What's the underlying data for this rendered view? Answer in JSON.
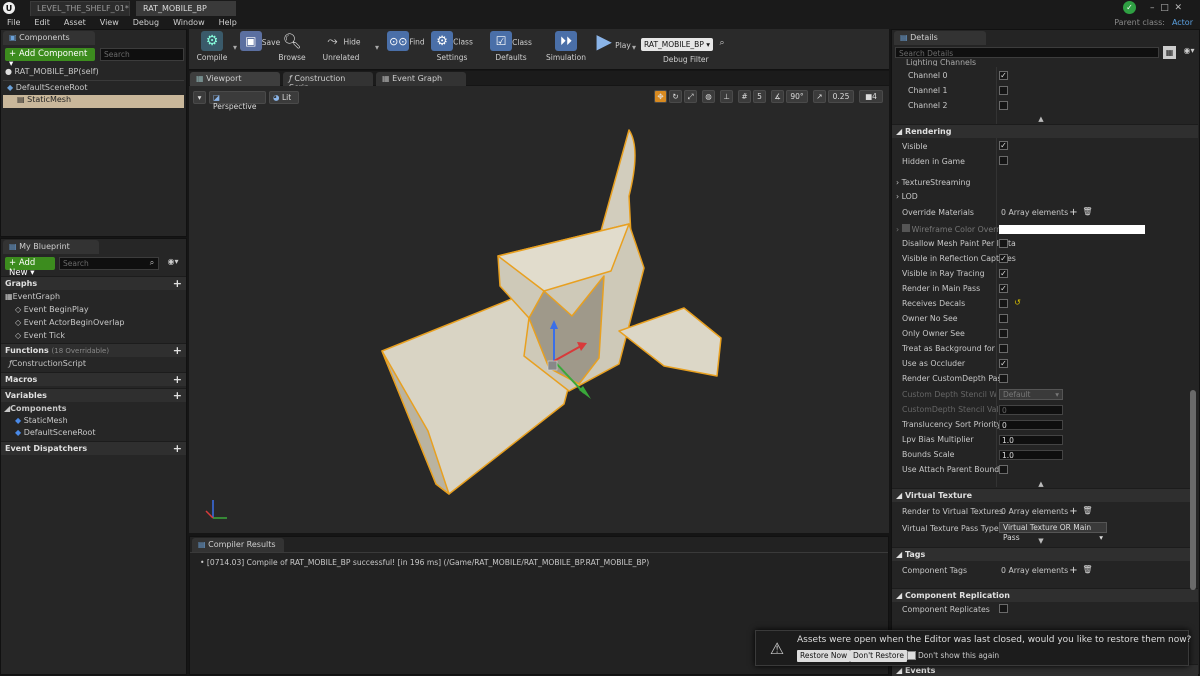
{
  "titlebar": {
    "tabs": [
      "LEVEL_THE_SHELF_01*",
      "RAT_MOBILE_BP"
    ],
    "parent_class_label": "Parent class:",
    "parent_class_value": "Actor"
  },
  "menu": [
    "File",
    "Edit",
    "Asset",
    "View",
    "Debug",
    "Window",
    "Help"
  ],
  "components": {
    "tab": "Components",
    "add_label": "+ Add Component",
    "search_placeholder": "Search",
    "self_label": "RAT_MOBILE_BP(self)",
    "items": [
      "DefaultSceneRoot",
      "StaticMesh"
    ]
  },
  "toolbar": {
    "buttons": [
      "Compile",
      "Save",
      "Browse",
      "Hide Unrelated",
      "Find",
      "Class Settings",
      "Class Defaults",
      "Simulation",
      "Play"
    ],
    "debug_select": "RAT_MOBILE_BP",
    "debug_label": "Debug Filter"
  },
  "editor_tabs": [
    "Viewport",
    "Construction Scrip",
    "Event Graph"
  ],
  "viewport": {
    "perspective": "Perspective",
    "lit": "Lit",
    "snap_angle": "90°",
    "snap_scale": "0.25",
    "snap_grid": "5",
    "camera_speed": "4"
  },
  "my_blueprint": {
    "tab": "My Blueprint",
    "add_label": "+ Add New",
    "search_placeholder": "Search",
    "graphs_header": "Graphs",
    "graph_items": [
      "EventGraph",
      "Event BeginPlay",
      "Event ActorBeginOverlap",
      "Event Tick"
    ],
    "functions_header": "Functions",
    "functions_note": "(18 Overridable)",
    "function_items": [
      "ConstructionScript"
    ],
    "macros_header": "Macros",
    "variables_header": "Variables",
    "components_sub": "Components",
    "variable_items": [
      "StaticMesh",
      "DefaultSceneRoot"
    ],
    "dispatchers_header": "Event Dispatchers"
  },
  "compiler": {
    "tab": "Compiler Results",
    "message": "[0714.03] Compile of RAT_MOBILE_BP successful! [in 196 ms] (/Game/RAT_MOBILE/RAT_MOBILE_BP.RAT_MOBILE_BP)"
  },
  "details": {
    "tab": "Details",
    "search_placeholder": "Search Details",
    "cut_row": "Lighting Channels",
    "channels": [
      {
        "label": "Channel 0",
        "checked": true
      },
      {
        "label": "Channel 1",
        "checked": false
      },
      {
        "label": "Channel 2",
        "checked": false
      }
    ],
    "rendering_header": "Rendering",
    "rendering_top": [
      {
        "label": "Visible",
        "checked": true
      },
      {
        "label": "Hidden in Game",
        "checked": false
      }
    ],
    "texture_streaming": "TextureStreaming",
    "lod": "LOD",
    "override_materials": {
      "label": "Override Materials",
      "value": "0 Array elements"
    },
    "wireframe": "Wireframe Color Override",
    "rendering_rows": [
      {
        "label": "Disallow Mesh Paint Per Insta",
        "checked": false
      },
      {
        "label": "Visible in Reflection Captures",
        "checked": true
      },
      {
        "label": "Visible in Ray Tracing",
        "checked": true
      },
      {
        "label": "Render in Main Pass",
        "checked": true
      },
      {
        "label": "Receives Decals",
        "checked": false
      },
      {
        "label": "Owner No See",
        "checked": false
      },
      {
        "label": "Only Owner See",
        "checked": false
      },
      {
        "label": "Treat as Background for Occlu",
        "checked": false
      },
      {
        "label": "Use as Occluder",
        "checked": true
      },
      {
        "label": "Render CustomDepth Pass",
        "checked": false
      }
    ],
    "stencil_write": {
      "label": "Custom Depth Stencil Write M",
      "value": "Default"
    },
    "stencil_value": {
      "label": "CustomDepth Stencil Value",
      "value": "0"
    },
    "translucency": {
      "label": "Translucency Sort Priority",
      "value": "0"
    },
    "lpv": {
      "label": "Lpv Bias Multiplier",
      "value": "1.0"
    },
    "bounds": {
      "label": "Bounds Scale",
      "value": "1.0"
    },
    "attach_parent": {
      "label": "Use Attach Parent Bound",
      "checked": false
    },
    "vt_header": "Virtual Texture",
    "vt_render": {
      "label": "Render to Virtual Textures",
      "value": "0 Array elements"
    },
    "vt_pass": {
      "label": "Virtual Texture Pass Type",
      "value": "Virtual Texture OR Main Pass"
    },
    "tags_header": "Tags",
    "component_tags": {
      "label": "Component Tags",
      "value": "0 Array elements"
    },
    "replication_header": "Component Replication",
    "component_replicates": {
      "label": "Component Replicates",
      "checked": false
    },
    "events_header": "Events"
  },
  "notification": {
    "message": "Assets were open when the Editor was last closed, would you like to restore them now?",
    "restore": "Restore Now",
    "dont_restore": "Don't Restore",
    "dont_show": "Don't show this again"
  },
  "colors": {
    "accent_green": "#3c8c1e",
    "mesh_fill": "#d9d4c4",
    "mesh_outline": "#e8a020",
    "viewport_bg": "#282828"
  }
}
